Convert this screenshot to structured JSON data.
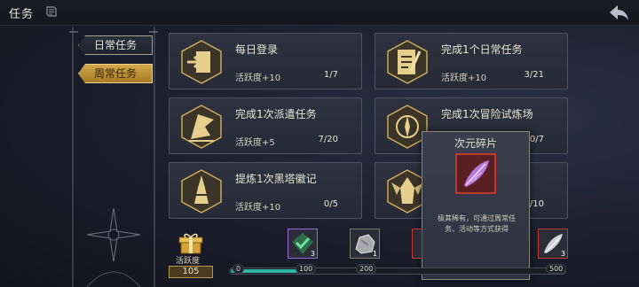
{
  "header": {
    "title": "任务",
    "title_icon": "scroll-icon",
    "back_icon": "back-arrow-icon"
  },
  "tabs": [
    {
      "label": "日常任务",
      "active": false
    },
    {
      "label": "周常任务",
      "active": true
    }
  ],
  "tasks": [
    {
      "name": "每日登录",
      "reward": "活跃度+10",
      "progress": "1/7",
      "icon": "door-exit-icon"
    },
    {
      "name": "完成1个日常任务",
      "reward": "活跃度+10",
      "progress": "3/21",
      "icon": "checklist-icon"
    },
    {
      "name": "完成1次派遣任务",
      "reward": "活跃度+5",
      "progress": "7/20",
      "icon": "flag-dispatch-icon"
    },
    {
      "name": "完成1次冒险试炼场",
      "reward": "",
      "progress": "0/7",
      "icon": "compass-icon"
    },
    {
      "name": "提炼1次黑塔徽记",
      "reward": "活跃度+10",
      "progress": "0/5",
      "icon": "tower-icon"
    },
    {
      "name": "",
      "reward": "",
      "progress": "0/10",
      "icon": "winged-helm-icon"
    }
  ],
  "tooltip": {
    "title": "次元碎片",
    "item_icon": "purple-feather-shard-icon",
    "description": "极其稀有，可通过周常任务、活动等方式获得"
  },
  "activity": {
    "label": "活跃度",
    "value": "105",
    "ticks": [
      "0",
      "100",
      "200",
      "500"
    ],
    "fill_fraction": 0.21,
    "rewards": [
      {
        "icon": "green-check-chest-icon",
        "count": "3"
      },
      {
        "icon": "silver-ore-icon",
        "count": "1"
      },
      {
        "icon": "red-box-icon",
        "count": ""
      },
      {
        "icon": "silver-feather-icon",
        "count": "3"
      }
    ]
  }
}
